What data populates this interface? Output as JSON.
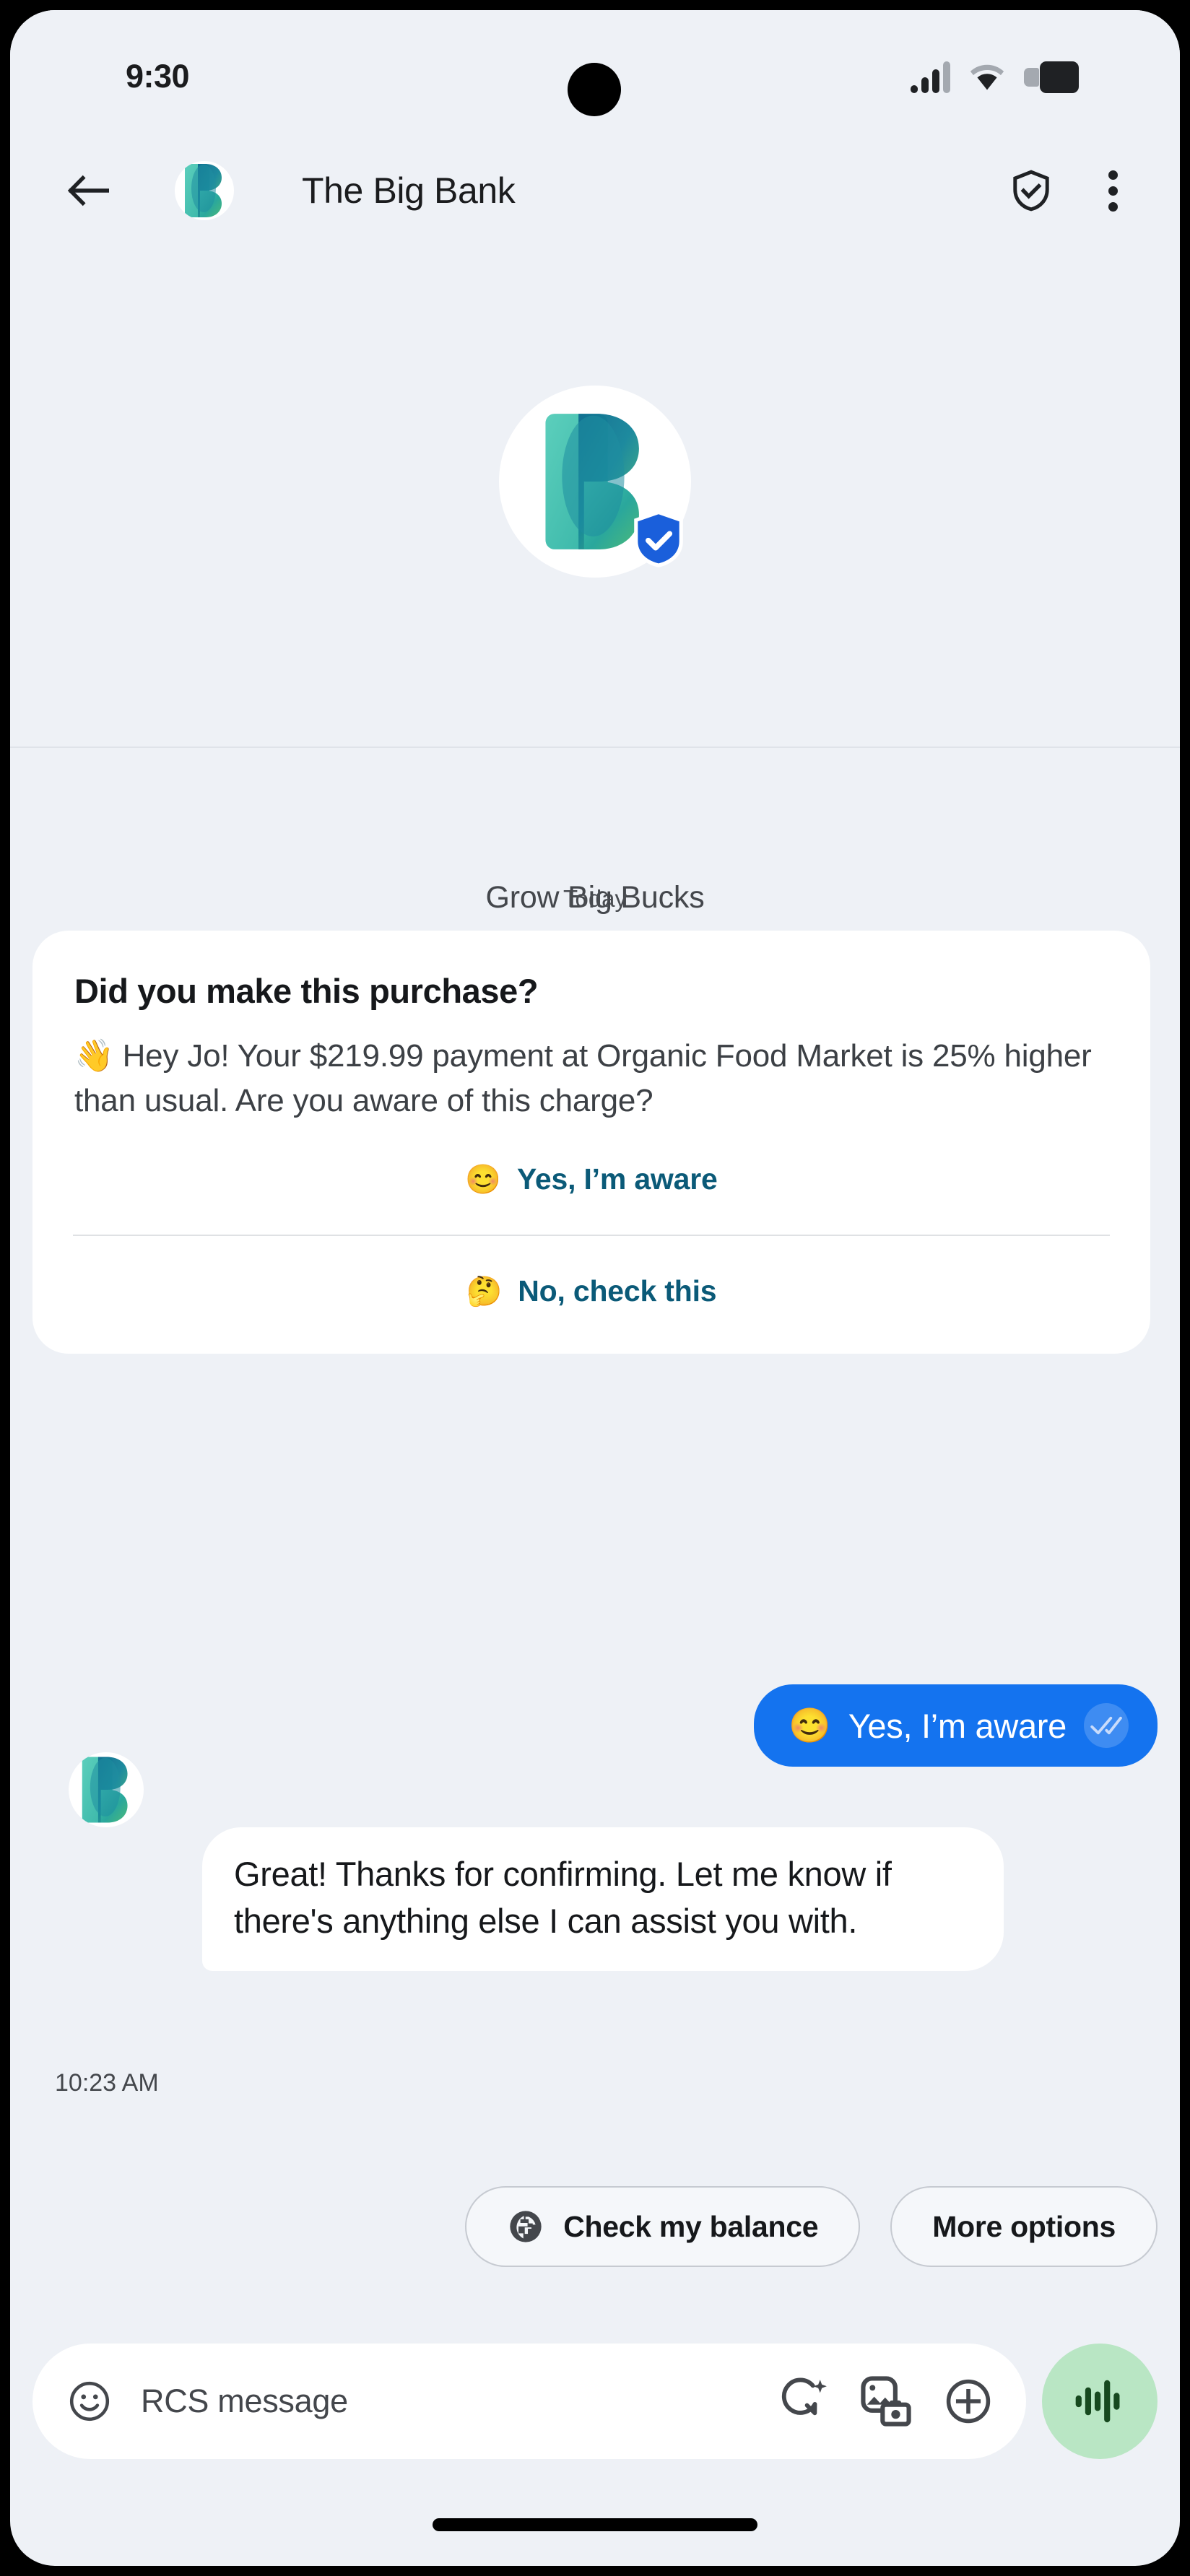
{
  "status_bar": {
    "time": "9:30",
    "icons": [
      "signal-icon",
      "wifi-icon",
      "battery-icon"
    ]
  },
  "app_bar": {
    "back_icon": "back-arrow-icon",
    "avatar_icon": "big-bank-logo",
    "title": "The Big Bank",
    "verified_icon": "shield-check-icon",
    "overflow_icon": "more-vert-icon"
  },
  "brand_header": {
    "avatar_icon": "big-bank-logo",
    "verified_badge_icon": "verified-shield-badge",
    "name": "Grow Big Bucks"
  },
  "conversation": {
    "day_divider": "Today",
    "rich_card": {
      "title": "Did you make this purchase?",
      "body": "👋 Hey Jo! Your $219.99 payment at Organic Food Market is 25% higher than usual. Are you aware of this charge?",
      "actions": [
        {
          "emoji": "😊",
          "label": "Yes, I’m aware"
        },
        {
          "emoji": "🤔",
          "label": "No, check this"
        }
      ]
    },
    "sent_message": {
      "emoji": "😊",
      "text": "Yes, I’m aware",
      "receipt_icon": "double-check-icon"
    },
    "received_message": {
      "avatar_icon": "big-bank-logo",
      "text": "Great! Thanks for confirming. Let me know if there's anything else I can assist you with."
    },
    "timestamp": "10:23 AM",
    "chips": [
      {
        "icon": "globe-icon",
        "label": "Check my balance"
      },
      {
        "icon": null,
        "label": "More options"
      }
    ]
  },
  "composer": {
    "emoji_icon": "emoji-smiley-icon",
    "placeholder": "RCS message",
    "value": "",
    "icons": [
      "magic-compose-icon",
      "gallery-camera-icon",
      "plus-circle-icon"
    ],
    "mic_icon": "voice-waveform-icon"
  },
  "colors": {
    "screen_bg": "#eef1f6",
    "card_bg": "#ffffff",
    "sent_bubble": "#1473ef",
    "link": "#0b5a78",
    "mic_bg": "#b9e6c4",
    "mic_fg": "#17491f",
    "brand_teal": "#3fc0ad",
    "brand_green": "#46b97a",
    "brand_deep": "#0e6f8f",
    "verified_blue": "#1a5fdb"
  }
}
